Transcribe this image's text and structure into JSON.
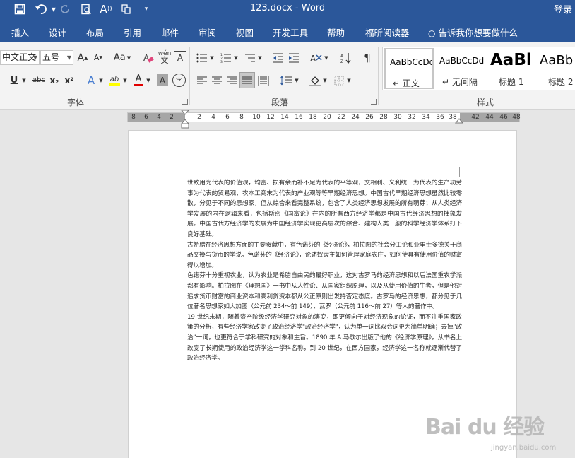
{
  "titlebar": {
    "doc_title": "123.docx  -  Word",
    "login": "登录",
    "quick_access": [
      "save-icon",
      "undo-icon",
      "redo-icon",
      "print-preview-icon",
      "read-aloud-icon",
      "touch-mode-icon",
      "customize-icon"
    ]
  },
  "tabs": [
    "插入",
    "设计",
    "布局",
    "引用",
    "邮件",
    "审阅",
    "视图",
    "开发工具",
    "帮助",
    "福昕阅读器"
  ],
  "tell_me": "告诉我你想要做什么",
  "font": {
    "family": "中文正文",
    "size": "五号",
    "group_label": "字体",
    "grow_label": "A",
    "shrink_label": "A",
    "case_label": "Aa",
    "phonetic_label": "wén",
    "border_char_label": "A",
    "underline_label": "U",
    "strike_label": "abc",
    "subscript_label": "x₂",
    "superscript_label": "x²",
    "effects_label": "A",
    "highlight_label": "ab",
    "color_label": "A",
    "shading_label": "A",
    "enclose_label": "字"
  },
  "paragraph": {
    "group_label": "段落"
  },
  "styles": {
    "group_label": "样式",
    "items": [
      {
        "sample": "AaBbCcDd",
        "name": "↵ 正文",
        "selected": true
      },
      {
        "sample": "AaBbCcDd",
        "name": "↵ 无间隔",
        "selected": false
      },
      {
        "sample": "AaBl",
        "name": "标题 1",
        "selected": false
      },
      {
        "sample": "AaBb",
        "name": "标题 2",
        "selected": false
      }
    ]
  },
  "ruler": {
    "left_numbers": [
      "8",
      "6",
      "4",
      "2"
    ],
    "right_numbers": [
      "2",
      "4",
      "6",
      "8",
      "10",
      "12",
      "14",
      "16",
      "18",
      "20",
      "22",
      "24",
      "26",
      "28",
      "30",
      "32",
      "34",
      "36",
      "38"
    ],
    "end_numbers": [
      "42",
      "44",
      "46",
      "48"
    ]
  },
  "document": {
    "paragraphs": [
      "世致用为代表的价值观，均富、损有余而补不足为代表的平等观，交相利、义利统一为代表的生产功劳事为代表的贸易观，农本工商末为代表的产业观等等早期经济思想。中国古代早期经济思想虽然比较零散，分见于不同的思想家，但从综合来看完整系统，包含了人类经济思想发展的所有萌芽；从人类经济学发展的内在逻辑来看，包括斯密《国富论》在内的所有西方经济学都是中国古代经济思想的抽象发展。中国古代方经济学的发展为中国经济学实现更高层次的综合、建构人类一般的科学经济学体系打下良好基础。",
      "古希腊在经济思想方面的主要贡献中，有色诺芬的《经济论》，柏拉图的社会分工论和亚里士多德关于商品交换与货币的学说。色诺芬的《经济论》，论述奴隶主如何管理家庭农庄，如何使具有使用价值的财富得以增加。",
      "色诺芬十分重视农业，认为农业是希腊自由民的最好职业，这对古罗马的经济思想和以后法国重农学派都有影响。柏拉图在《理想国》一书中从人性论、从国家组织原理，以及从使用价值的生者，但是他对追求货币财富的商业资本和高利贷资本都从公正原则出发持否定态度。古罗马的经济思想，都分见于几位著名思想家如大加图（公元前 234～前 149）、瓦罗（公元前 116～前 27）等人的著作中。",
      "19 世纪末期，随着资产阶级经济学研究对象的演变，即更倾向于对经济现象的论证，而不注重国家政策的分析，有些经济学家改变了政治经济学\"政治经济学\"，认为单一词比双合词更为简单明确；去掉\"政治\"一词，也更符合于学科研究的对象和主旨。1890 年 A.马歇尔出版了他的《经济学原理》，从书名上改变了长期使用的政治经济学这一学科名称，到 20 世纪，在西方国家，经济学这一名称就逐渐代替了政治经济学。"
    ]
  },
  "watermark": {
    "brand": "Bai du 经验",
    "url": "jingyan.baidu.com"
  }
}
